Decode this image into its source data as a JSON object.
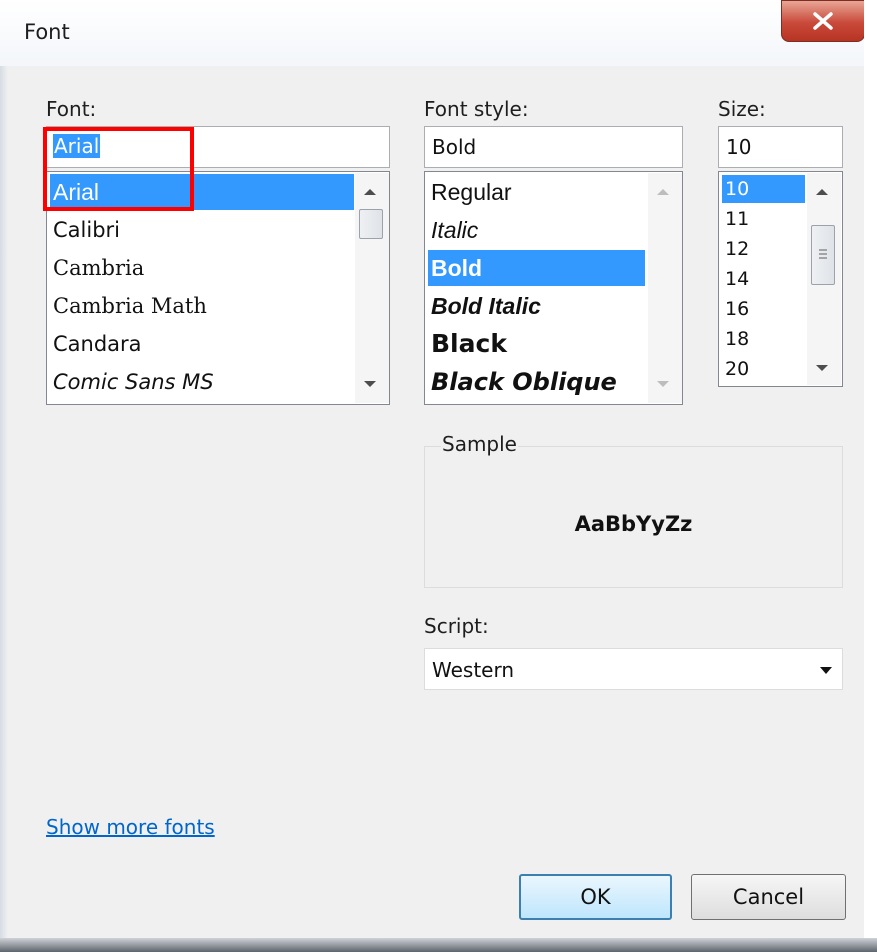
{
  "window": {
    "title": "Font",
    "close_glyph": "✕"
  },
  "font": {
    "label": "Font:",
    "value": "Arial",
    "items": [
      "Arial",
      "Calibri",
      "Cambria",
      "Cambria Math",
      "Candara",
      "Comic Sans MS"
    ],
    "selected": "Arial"
  },
  "style": {
    "label": "Font style:",
    "value": "Bold",
    "items": [
      "Regular",
      "Italic",
      "Bold",
      "Bold Italic",
      "Black",
      "Black Oblique"
    ],
    "selected": "Bold"
  },
  "size": {
    "label": "Size:",
    "value": "10",
    "items": [
      "10",
      "11",
      "12",
      "14",
      "16",
      "18",
      "20"
    ],
    "selected": "10"
  },
  "sample": {
    "label": "Sample",
    "text": "AaBbYyZz"
  },
  "script": {
    "label": "Script:",
    "value": "Western"
  },
  "links": {
    "show_more": "Show more fonts"
  },
  "buttons": {
    "ok": "OK",
    "cancel": "Cancel"
  },
  "colors": {
    "selection": "#3399ff",
    "highlight_box": "#ff0000",
    "link": "#0066cc",
    "close": "#c9493a"
  }
}
